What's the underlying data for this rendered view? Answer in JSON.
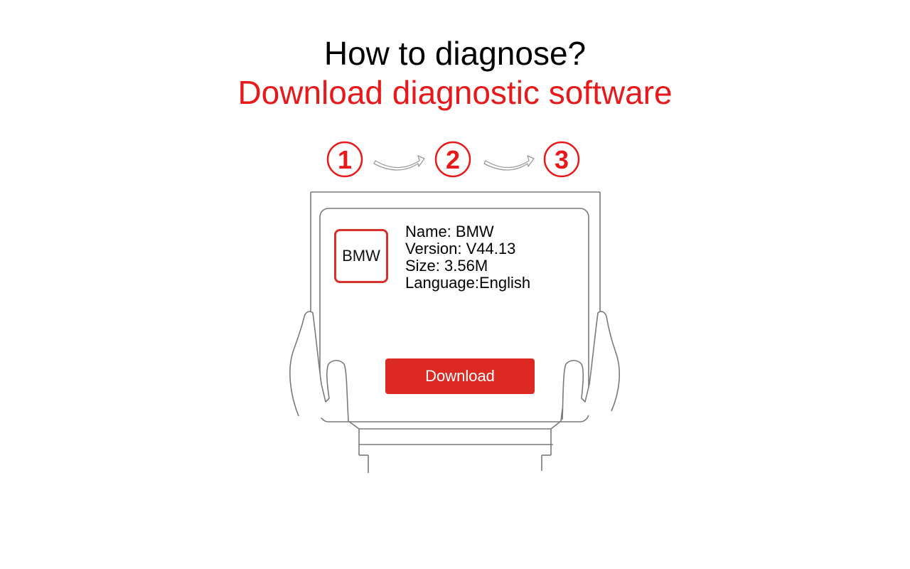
{
  "header": {
    "question": "How to diagnose?",
    "subtitle": "Download diagnostic software"
  },
  "steps": [
    {
      "label": "1",
      "state": "current"
    },
    {
      "label": "2",
      "state": "upcoming"
    },
    {
      "label": "3",
      "state": "upcoming"
    }
  ],
  "software": {
    "icon_label": "BMW",
    "name_line": "Name: BMW",
    "version_line": "Version: V44.13",
    "size_line": "Size: 3.56M",
    "language_line": "Language:English"
  },
  "actions": {
    "download_label": "Download"
  },
  "colors": {
    "accent": "#e8191b",
    "button": "#dc2a22",
    "outline": "#7a7a7a"
  }
}
